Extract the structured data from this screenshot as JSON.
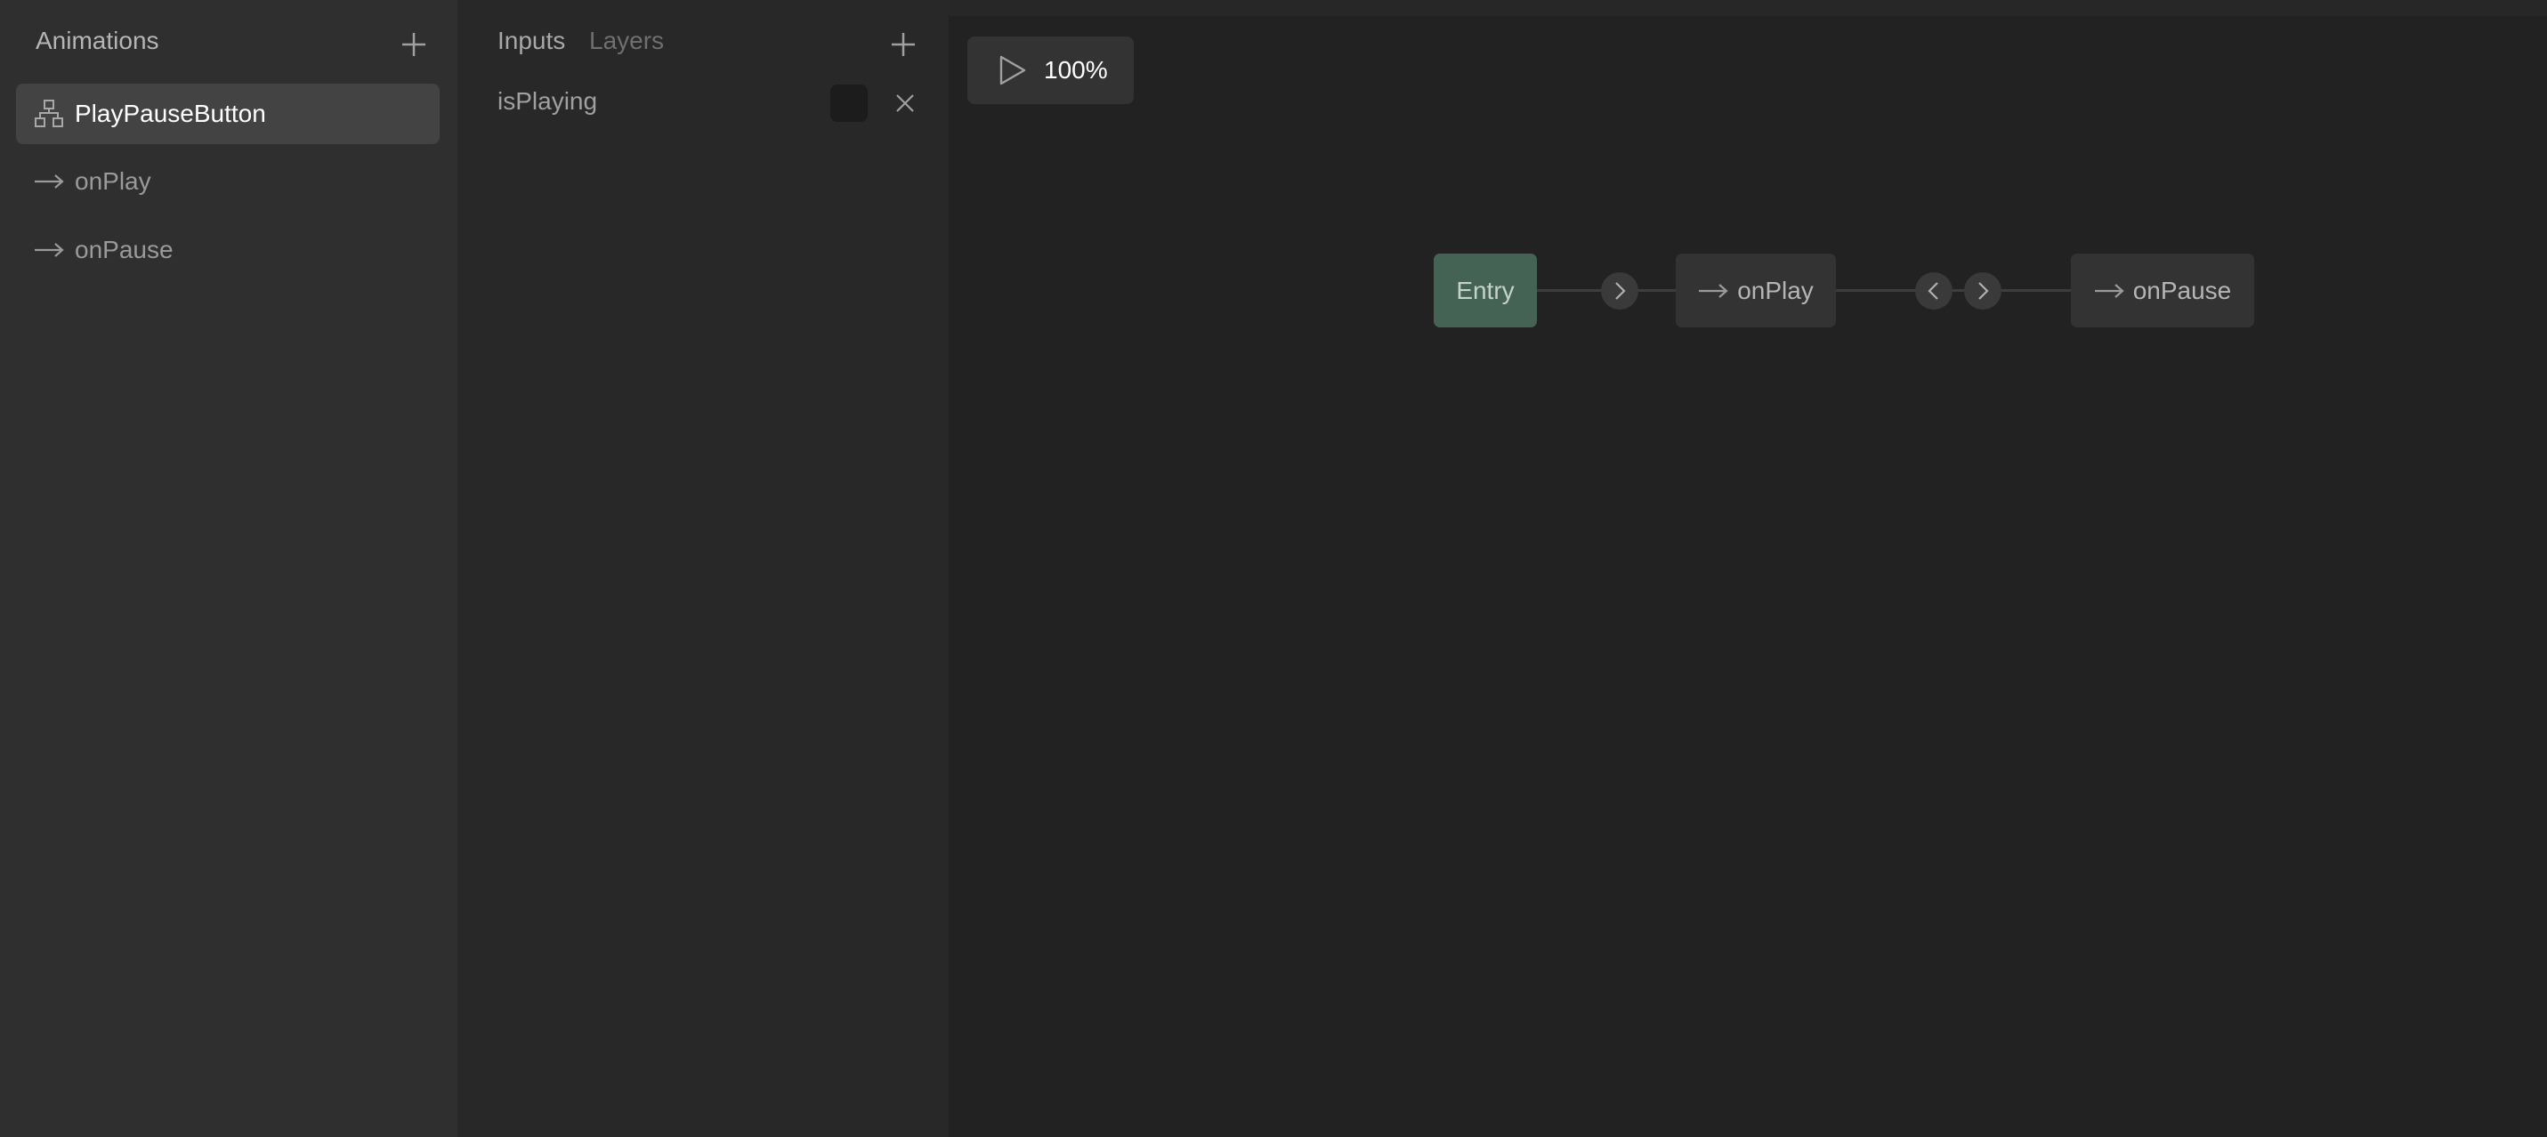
{
  "animations_panel": {
    "title": "Animations",
    "items": [
      {
        "label": "PlayPauseButton",
        "icon": "state-machine-icon",
        "selected": true
      },
      {
        "label": "onPlay",
        "icon": "arrow-right-icon",
        "selected": false
      },
      {
        "label": "onPause",
        "icon": "arrow-right-icon",
        "selected": false
      }
    ]
  },
  "inputs_panel": {
    "tabs": [
      {
        "label": "Inputs",
        "active": true
      },
      {
        "label": "Layers",
        "active": false
      }
    ],
    "inputs": [
      {
        "name": "isPlaying",
        "type": "boolean",
        "value": false
      }
    ]
  },
  "toolbar": {
    "zoom": "100%"
  },
  "graph": {
    "nodes": [
      {
        "id": "entry",
        "label": "Entry"
      },
      {
        "id": "onPlay",
        "label": "onPlay"
      },
      {
        "id": "onPause",
        "label": "onPause"
      }
    ]
  },
  "colors": {
    "entry_node": "#446355",
    "state_node": "#333333",
    "selected_item": "#434343",
    "canvas": "#222222"
  }
}
